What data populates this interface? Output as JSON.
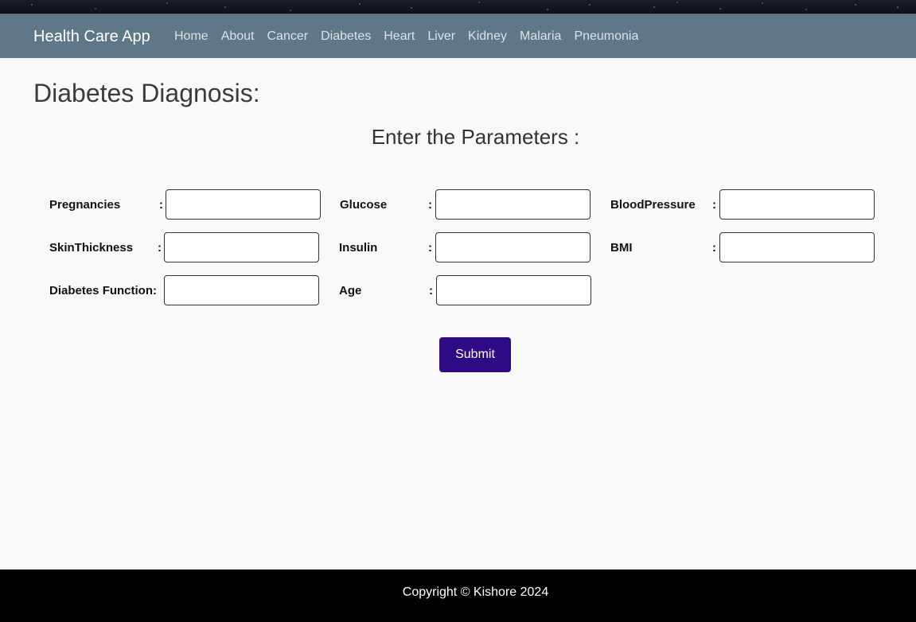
{
  "navbar": {
    "brand": "Health Care App",
    "links": [
      "Home",
      "About",
      "Cancer",
      "Diabetes",
      "Heart",
      "Liver",
      "Kidney",
      "Malaria",
      "Pneumonia"
    ]
  },
  "page": {
    "title": "Diabetes Diagnosis:",
    "subtitle": "Enter the Parameters :"
  },
  "form": {
    "colon": ":",
    "fields": [
      {
        "label": "Pregnancies",
        "value": "",
        "placeholder": ""
      },
      {
        "label": "Glucose",
        "value": "",
        "placeholder": ""
      },
      {
        "label": "BloodPressure",
        "value": "",
        "placeholder": ""
      },
      {
        "label": "SkinThickness",
        "value": "",
        "placeholder": ""
      },
      {
        "label": "Insulin",
        "value": "",
        "placeholder": ""
      },
      {
        "label": "BMI",
        "value": "",
        "placeholder": ""
      },
      {
        "label": "Diabetes Function:",
        "value": "",
        "placeholder": ""
      },
      {
        "label": "Age",
        "value": "",
        "placeholder": ""
      }
    ],
    "submit_label": "Submit"
  },
  "footer": {
    "text": "Copyright © Kishore 2024"
  },
  "colors": {
    "navbar": "#607788",
    "submit": "#2e0b85",
    "footer": "#000000",
    "background": "#f9f9f9"
  }
}
